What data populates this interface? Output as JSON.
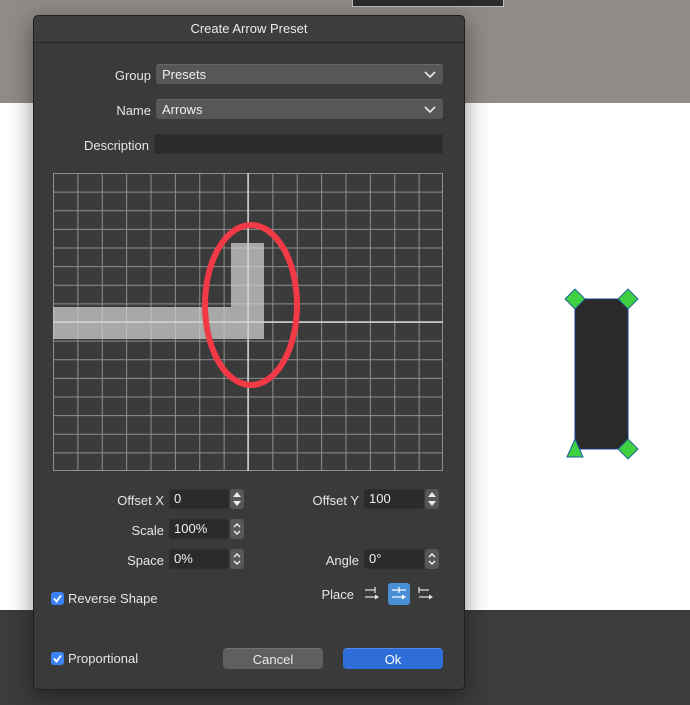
{
  "dialog": {
    "title": "Create Arrow Preset",
    "group": {
      "label": "Group",
      "value": "Presets"
    },
    "name": {
      "label": "Name",
      "value": "Arrows"
    },
    "description": {
      "label": "Description",
      "value": ""
    },
    "offset_x": {
      "label": "Offset X",
      "value": "0"
    },
    "offset_y": {
      "label": "Offset Y",
      "value": "100"
    },
    "scale": {
      "label": "Scale",
      "value": "100%"
    },
    "space": {
      "label": "Space",
      "value": "0%"
    },
    "angle": {
      "label": "Angle",
      "value": "0°"
    },
    "place": {
      "label": "Place",
      "selected_index": 1
    },
    "reverse_shape": {
      "label": "Reverse Shape",
      "checked": true
    },
    "proportional": {
      "label": "Proportional",
      "checked": true
    },
    "cancel_label": "Cancel",
    "ok_label": "Ok"
  },
  "colors": {
    "accent": "#2f6ed9",
    "annotation": "#f23a47",
    "handle": "#3fd13f"
  }
}
